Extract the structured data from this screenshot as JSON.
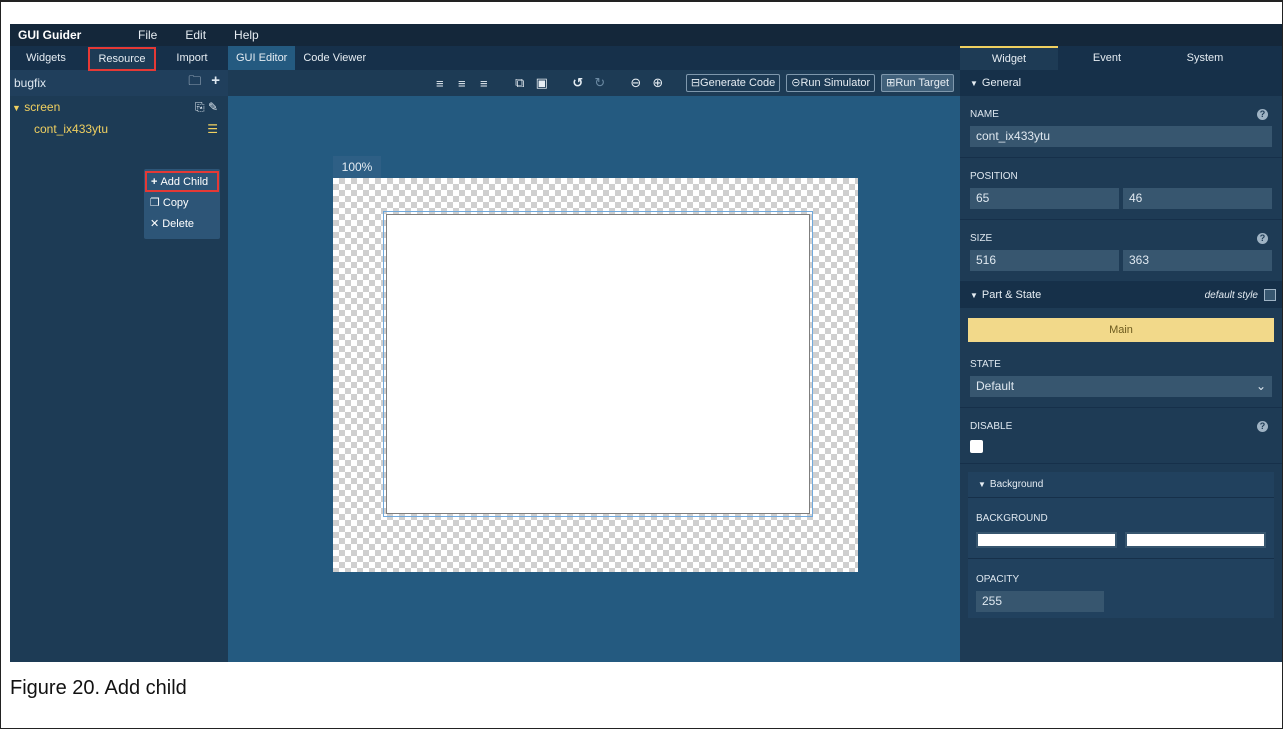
{
  "app": {
    "brand": "GUI Guider",
    "menus": [
      "File",
      "Edit",
      "Help"
    ]
  },
  "left": {
    "tabs": [
      "Widgets",
      "Resource",
      "Import"
    ],
    "active_tab": "Resource",
    "project": "bugfix",
    "tree": {
      "screen": "screen",
      "child": "cont_ix433ytu"
    },
    "context_menu": [
      "Add Child",
      "Copy",
      "Delete"
    ]
  },
  "center": {
    "tabs": [
      "GUI Editor",
      "Code Viewer"
    ],
    "zoom": "100%",
    "toolbar_buttons": [
      "Generate Code",
      "Run Simulator",
      "Run Target"
    ]
  },
  "right": {
    "tabs": [
      "Widget",
      "Event",
      "System"
    ],
    "general": "General",
    "name_label": "NAME",
    "name_value": "cont_ix433ytu",
    "position_label": "POSITION",
    "pos_x": "65",
    "pos_y": "46",
    "size_label": "SIZE",
    "size_w": "516",
    "size_h": "363",
    "part_state": "Part & State",
    "default_style": "default style",
    "main": "Main",
    "state_label": "STATE",
    "state_value": "Default",
    "disable_label": "DISABLE",
    "background_section": "Background",
    "background_label": "BACKGROUND",
    "opacity_label": "OPACITY",
    "opacity_value": "255"
  },
  "caption": "Figure 20.  Add child",
  "colors": {
    "menubar": "#14273a",
    "panel": "#1d3b55",
    "canvas_area": "#245a80",
    "highlight": "#e53935",
    "accent_yellow": "#f0d060",
    "main_button": "#f2d98a"
  }
}
